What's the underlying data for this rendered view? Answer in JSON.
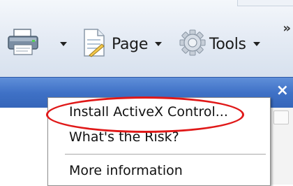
{
  "toolbar": {
    "buttons": [
      {
        "icon": "printer-icon",
        "label": ""
      },
      {
        "icon": "page-icon",
        "label": "Page"
      },
      {
        "icon": "tools-gear-icon",
        "label": "Tools"
      }
    ],
    "overflow_chevron": "»"
  },
  "infobar": {
    "close_glyph": "×",
    "color": "#3f71c6"
  },
  "context_menu": {
    "items": [
      {
        "label": "Install ActiveX Control..."
      },
      {
        "label": "What's the Risk?"
      },
      {
        "label": "More information"
      }
    ],
    "highlight_color": "#e01818"
  }
}
